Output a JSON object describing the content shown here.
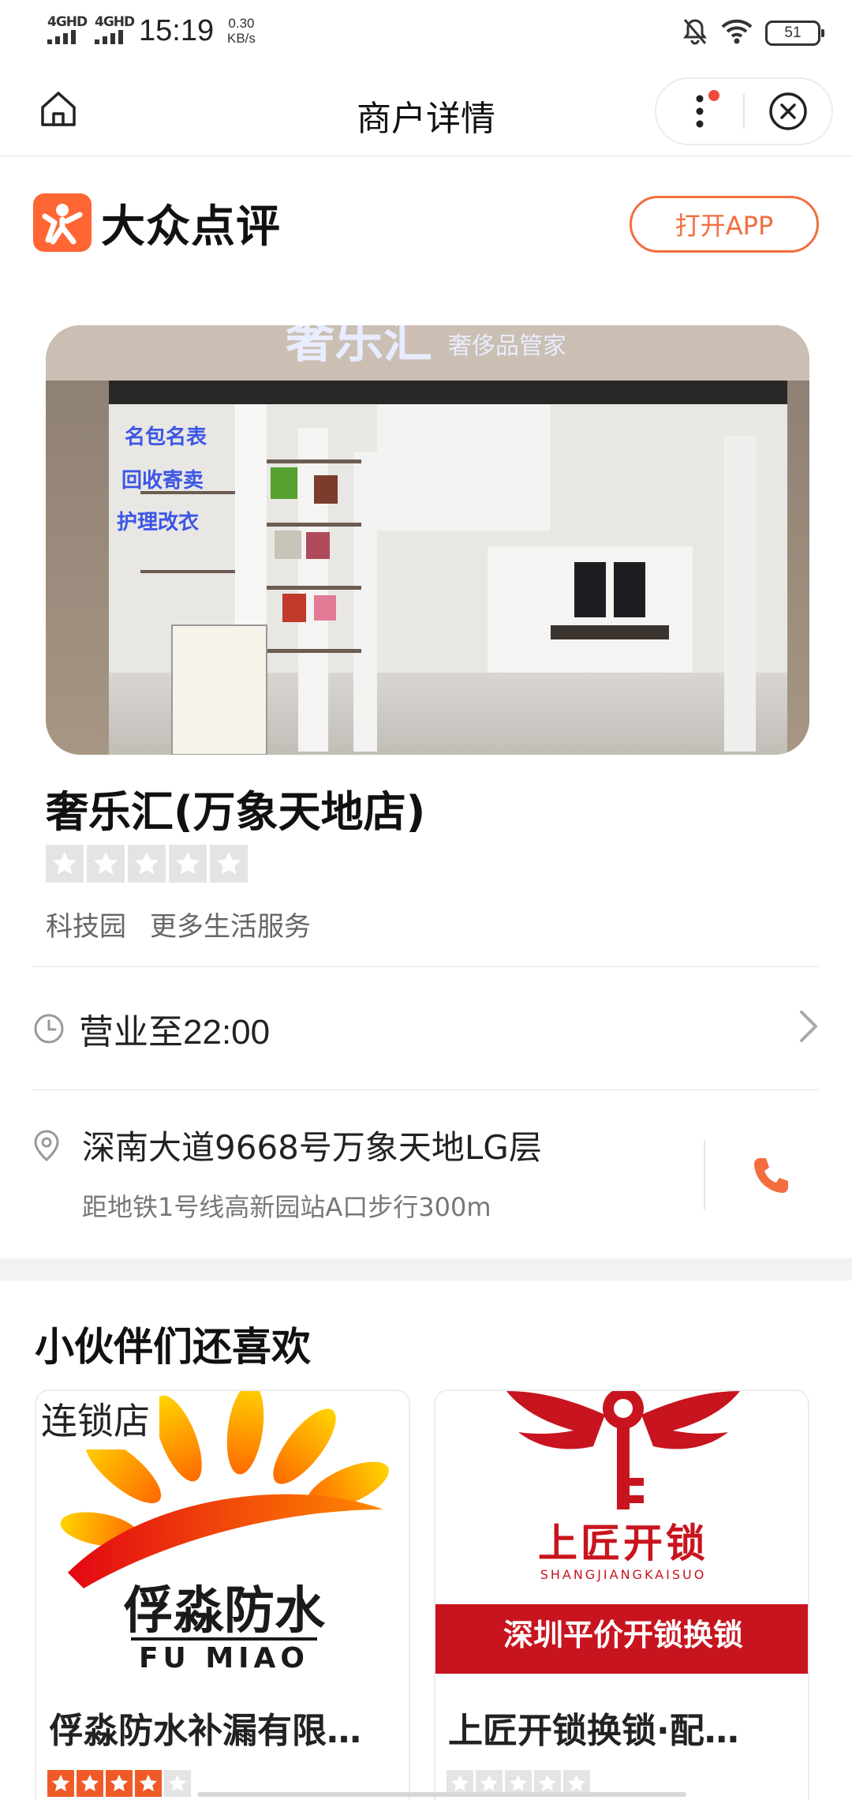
{
  "status_bar": {
    "signal1": "4GHD",
    "signal2": "4GHD",
    "time": "15:19",
    "speed_value": "0.30",
    "speed_unit": "KB/s",
    "battery": "51"
  },
  "nav": {
    "title": "商户详情"
  },
  "brand": {
    "name": "大众点评",
    "open_app": "打开APP"
  },
  "hero": {
    "sign_main": "奢乐汇",
    "sign_sub": "奢侈品管家",
    "window_lines": [
      "名包名表",
      "回收寄卖",
      "护理改衣"
    ]
  },
  "shop": {
    "name": "奢乐汇(万象天地店)",
    "rating_stars": 0,
    "area": "科技园",
    "category": "更多生活服务",
    "hours": "营业至22:00",
    "address": "深南大道9668号万象天地LG层",
    "distance": "距地铁1号线高新园站A口步行300m"
  },
  "recommend": {
    "title": "小伙伴们还喜欢",
    "items": [
      {
        "badge": "连锁店",
        "logo_cn": "俘淼防水",
        "logo_en": "FU MIAO",
        "name": "俘淼防水补漏有限…",
        "rating": 4
      },
      {
        "logo_cn": "上匠开锁",
        "logo_en": "SHANGJIANGKAISUO",
        "banner": "深圳平价开锁换锁",
        "name": "上匠开锁换锁·配…",
        "rating": 0
      }
    ]
  },
  "colors": {
    "accent": "#f36d3f",
    "brand_orange": "#ff6633",
    "star_off": "#e4e4e4",
    "star_on": "#f05a28"
  }
}
